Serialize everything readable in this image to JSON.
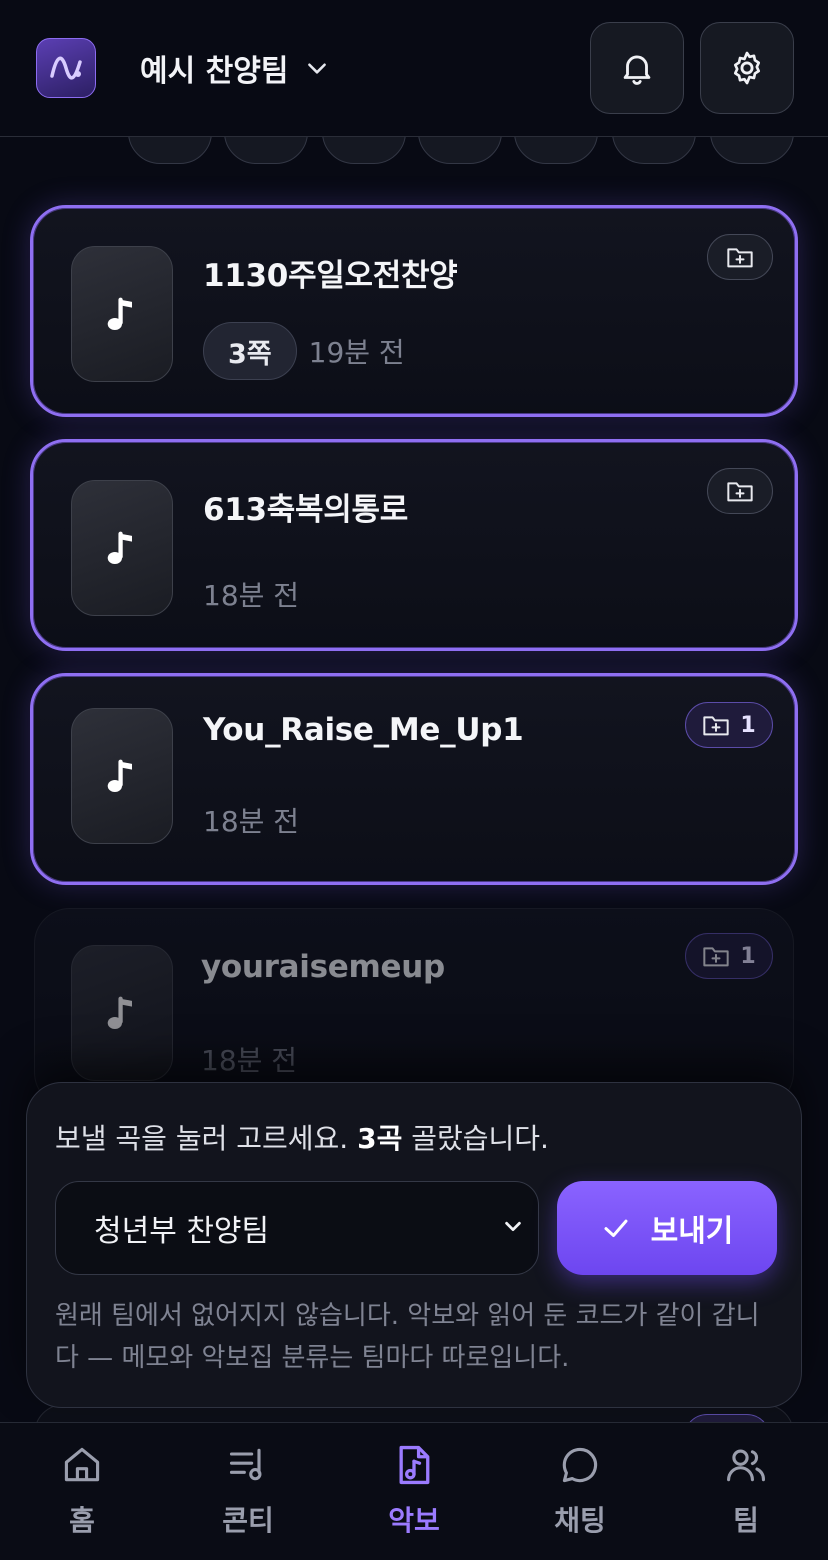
{
  "header": {
    "team_name": "예시 찬양팀",
    "brand_color": "#8c6cf0"
  },
  "sheets": [
    {
      "title": "1130주일오전찬양",
      "pages": "3쪽",
      "time": "19분 전",
      "selected": true,
      "folder_count": ""
    },
    {
      "title": "613축복의통로",
      "pages": "",
      "time": "18분 전",
      "selected": true,
      "folder_count": ""
    },
    {
      "title": "You_Raise_Me_Up1",
      "pages": "",
      "time": "18분 전",
      "selected": true,
      "folder_count": "1"
    },
    {
      "title": "youraisemeup",
      "pages": "",
      "time": "18분 전",
      "selected": false,
      "folder_count": "1"
    }
  ],
  "send_sheet": {
    "message_prefix": "보낼 곡을 눌러 고르세요. ",
    "message_count": "3곡",
    "message_suffix": " 골랐습니다.",
    "target_team": "청년부 찬양팀",
    "send_label": "보내기",
    "note": "원래 팀에서 없어지지 않습니다. 악보와 읽어 둔 코드가 같이 갑니다 — 메모와 악보집 분류는 팀마다 따로입니다."
  },
  "nav": {
    "items": [
      {
        "label": "홈",
        "icon": "home-icon",
        "active": false
      },
      {
        "label": "콘티",
        "icon": "setlist-icon",
        "active": false
      },
      {
        "label": "악보",
        "icon": "sheet-music-icon",
        "active": true
      },
      {
        "label": "채팅",
        "icon": "chat-icon",
        "active": false
      },
      {
        "label": "팀",
        "icon": "team-icon",
        "active": false
      }
    ],
    "active_color": "#9b7bff"
  }
}
